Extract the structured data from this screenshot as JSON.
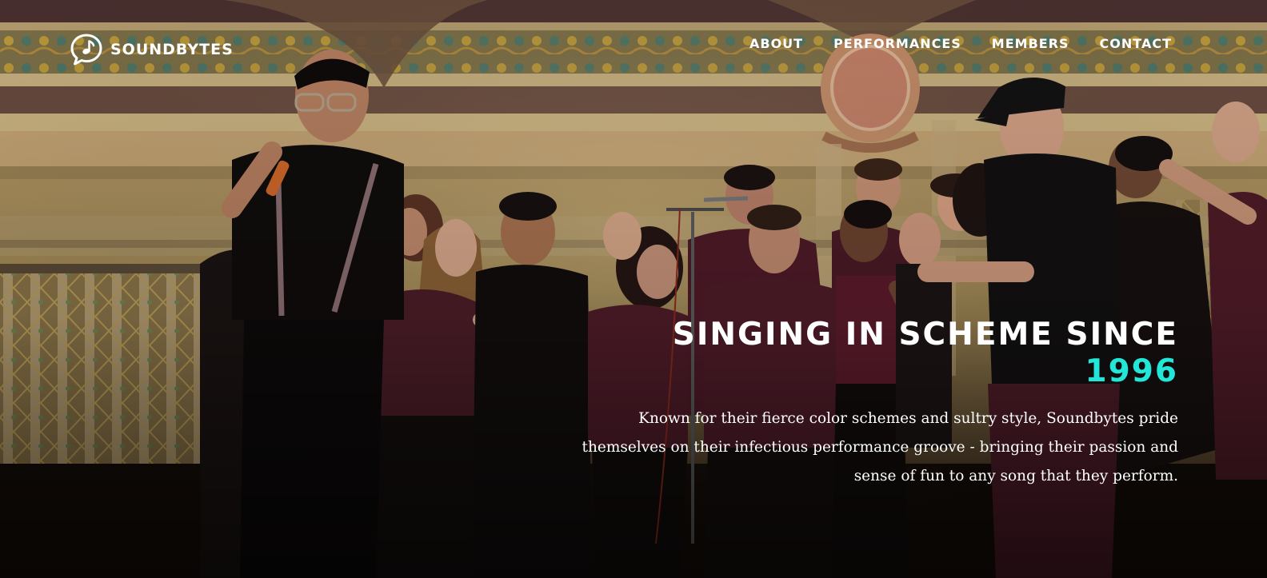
{
  "nav": {
    "brand": "SOUNDBYTES",
    "links": [
      {
        "label": "ABOUT"
      },
      {
        "label": "PERFORMANCES"
      },
      {
        "label": "MEMBERS"
      },
      {
        "label": "CONTACT"
      }
    ]
  },
  "hero": {
    "headline": "SINGING IN SCHEME SINCE",
    "year": "1996",
    "description": "Known for their fierce color schemes and sultry style, Soundbytes pride themselves on their infectious performance groove - bringing their passion and sense of fun to any song that they perform.",
    "background_image": "photo of a cappella group singing on stage in ornate hall"
  },
  "colors": {
    "accent": "#22e6d8",
    "text": "#ffffff",
    "wall": "#a58c56",
    "shirts": "#4e1a28"
  }
}
